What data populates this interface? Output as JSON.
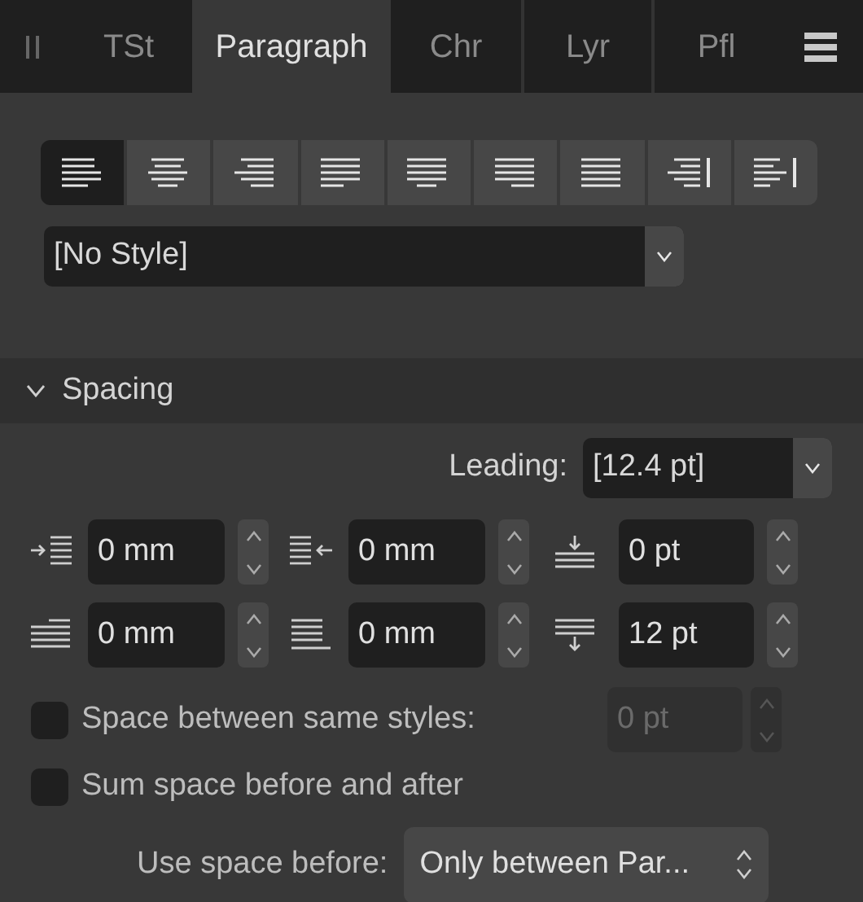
{
  "tabs": [
    {
      "label": "TSt",
      "selected": false
    },
    {
      "label": "Paragraph",
      "selected": true
    },
    {
      "label": "Chr",
      "selected": false
    },
    {
      "label": "Lyr",
      "selected": false
    },
    {
      "label": "Pfl",
      "selected": false
    }
  ],
  "alignment": [
    {
      "selected": true
    },
    {
      "selected": false
    },
    {
      "selected": false
    },
    {
      "selected": false
    },
    {
      "selected": false
    },
    {
      "selected": false
    },
    {
      "selected": false
    },
    {
      "selected": false
    },
    {
      "selected": false
    }
  ],
  "paragraph_style": {
    "value": "[No Style]"
  },
  "section": {
    "title": "Spacing",
    "expanded": true
  },
  "leading": {
    "label": "Leading:",
    "value": "[12.4 pt]"
  },
  "spacing_fields": [
    {
      "value": "0 mm"
    },
    {
      "value": "0 mm"
    },
    {
      "value": "0 pt"
    },
    {
      "value": "0 mm"
    },
    {
      "value": "0 mm"
    },
    {
      "value": "12 pt"
    }
  ],
  "options": [
    {
      "label": "Space between same styles:",
      "checked": false,
      "field": {
        "value": "0 pt",
        "disabled": true
      }
    },
    {
      "label": "Sum space before and after",
      "checked": false
    }
  ],
  "use_space_before": {
    "label": "Use space before:",
    "value": "Only between Par..."
  }
}
